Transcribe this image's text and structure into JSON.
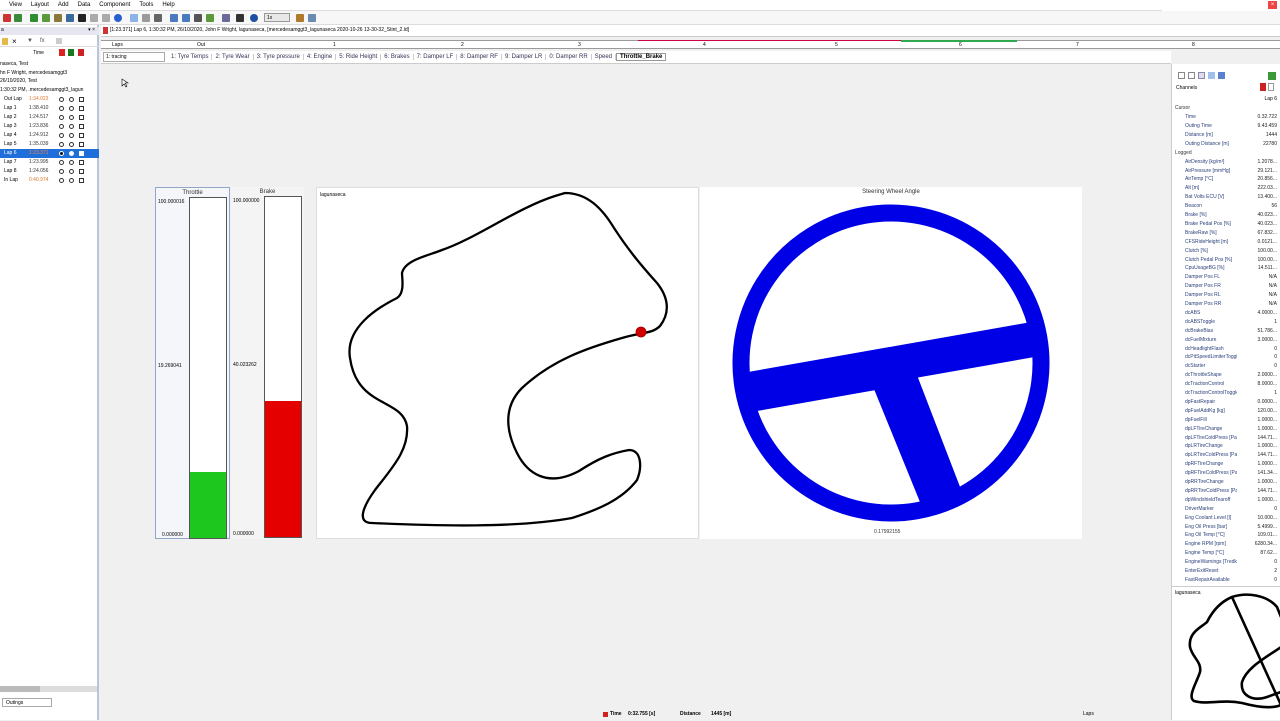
{
  "menu": {
    "items": [
      "View",
      "Layout",
      "Add",
      "Data",
      "Component",
      "Tools",
      "Help"
    ]
  },
  "toolbar": {
    "zoom_value": "1x"
  },
  "session": {
    "title": "[1:23.371] Lap 6, 1:30:32 PM, 26/10/2020, John F Wright, lagunaseca,  [mercedesamggt3_lagunaseca 2020-10-26 13-30-32_Stint_2.ld]"
  },
  "lapbar": {
    "label": "Laps",
    "out": "Out",
    "laps": [
      "1",
      "2",
      "3",
      "4",
      "5",
      "6",
      "7",
      "8"
    ]
  },
  "tabs": {
    "selector": "1: tracing",
    "items": [
      "1: Tyre Temps",
      "2: Tyre Wear",
      "3: Tyre pressure",
      "4: Engine",
      "5: Ride Height",
      "6: Brakes",
      "7: Damper LF",
      "8: Damper RF",
      "9: Damper LR",
      "0: Damper RR",
      "Speed",
      "Throttle_Brake"
    ]
  },
  "left": {
    "header_time": "Time",
    "session_name": "naseca, Test",
    "driver": "hn F Wright, mercedesamggt3",
    "date": "26/10/2020, Test",
    "stint": "1:30:32 PM, .mercedesamggt3_lagun",
    "laps": [
      {
        "name": "Out Lap",
        "time": "1:34.023",
        "color": "#e07b2c"
      },
      {
        "name": "Lap 1",
        "time": "1:38.410",
        "color": "#333"
      },
      {
        "name": "Lap 2",
        "time": "1:24.517",
        "color": "#333"
      },
      {
        "name": "Lap 3",
        "time": "1:23.836",
        "color": "#333"
      },
      {
        "name": "Lap 4",
        "time": "1:24.912",
        "color": "#333"
      },
      {
        "name": "Lap 5",
        "time": "1:35.039",
        "color": "#333"
      },
      {
        "name": "Lap 6",
        "time": "1:23.371",
        "color": "#e07b2c"
      },
      {
        "name": "Lap 7",
        "time": "1:23.995",
        "color": "#333"
      },
      {
        "name": "Lap 8",
        "time": "1:24.056",
        "color": "#333"
      },
      {
        "name": "In Lap",
        "time": "0:40.974",
        "color": "#e07b2c"
      }
    ],
    "footer_tab": "Outings"
  },
  "throttle": {
    "title": "Throttle",
    "max": "100.000016",
    "mid": "19.269041",
    "min": "0.000000",
    "level": 0.1927,
    "color": "#1ec71e"
  },
  "brake": {
    "title": "Brake",
    "max": "100.000000",
    "mid": "40.023262",
    "min": "0.000000",
    "level": 0.4002,
    "color": "#e50000"
  },
  "track": {
    "title": "lagunaseca"
  },
  "wheel": {
    "title": "Steering Wheel Angle",
    "value": "0.17992155",
    "color": "#0000e6"
  },
  "right": {
    "title": "Channels",
    "lap": "Lap 6",
    "cursor_header": "Cursor",
    "logged_header": "Logged",
    "cursor": [
      {
        "name": "Time",
        "value": "0.32.722"
      },
      {
        "name": "Outing Time",
        "value": "9.43.459"
      },
      {
        "name": "Distance [m]",
        "value": "1444"
      },
      {
        "name": "Outing Distance [m]",
        "value": "22780"
      }
    ],
    "logged": [
      {
        "name": "AirDensity [kg/m³]",
        "value": "1.2078..."
      },
      {
        "name": "AirPressure [mmHg]",
        "value": "29.121..."
      },
      {
        "name": "AirTemp [°C]",
        "value": "20.856..."
      },
      {
        "name": "Alt [m]",
        "value": "222.03..."
      },
      {
        "name": "Bat Volts ECU [V]",
        "value": "13.400..."
      },
      {
        "name": "Beacon",
        "value": "56"
      },
      {
        "name": "Brake [%]",
        "value": "40.023..."
      },
      {
        "name": "Brake Pedal Pos [%]",
        "value": "40.023..."
      },
      {
        "name": "BrakeRaw [%]",
        "value": "67.832..."
      },
      {
        "name": "CFSRideHeight [m]",
        "value": "0.0121..."
      },
      {
        "name": "Clutch [%]",
        "value": "100.00..."
      },
      {
        "name": "Clutch Pedal Pos [%]",
        "value": "100.00..."
      },
      {
        "name": "CpuUsageBG [%]",
        "value": "14.511..."
      },
      {
        "name": "Damper Pos FL",
        "value": "N/A"
      },
      {
        "name": "Damper Pos FR",
        "value": "N/A"
      },
      {
        "name": "Damper Pos RL",
        "value": "N/A"
      },
      {
        "name": "Damper Pos RR",
        "value": "N/A"
      },
      {
        "name": "dcABS",
        "value": "4.0000..."
      },
      {
        "name": "dcABSToggle",
        "value": "1"
      },
      {
        "name": "dcBrakeBias",
        "value": "51.786..."
      },
      {
        "name": "dcFuelMixture",
        "value": "3.0000..."
      },
      {
        "name": "dcHeadlightFlash",
        "value": "0"
      },
      {
        "name": "dcPitSpeedLimiterToggle",
        "value": "0"
      },
      {
        "name": "dcStarter",
        "value": "0"
      },
      {
        "name": "dcThrottleShape",
        "value": "2.0000..."
      },
      {
        "name": "dcTractionControl",
        "value": "8.0000..."
      },
      {
        "name": "dcTractionControlToggle",
        "value": "1"
      },
      {
        "name": "dpFastRepair",
        "value": "0.0000..."
      },
      {
        "name": "dpFuelAddKg [kg]",
        "value": "120.00..."
      },
      {
        "name": "dpFuelFill",
        "value": "1.0000..."
      },
      {
        "name": "dpLFTireChange",
        "value": "1.0000..."
      },
      {
        "name": "dpLFTireColdPress [Pa]",
        "value": "144.71..."
      },
      {
        "name": "dpLRTireChange",
        "value": "1.0000..."
      },
      {
        "name": "dpLRTireColdPress [Pa]",
        "value": "144.71..."
      },
      {
        "name": "dpRFTireChange",
        "value": "1.0000..."
      },
      {
        "name": "dpRFTireColdPress [Pa]",
        "value": "141.34..."
      },
      {
        "name": "dpRRTireChange",
        "value": "1.0000..."
      },
      {
        "name": "dpRRTireColdPress [Pa]",
        "value": "144.71..."
      },
      {
        "name": "dpWindshieldTearoff",
        "value": "1.0000..."
      },
      {
        "name": "DriverMarker",
        "value": "0"
      },
      {
        "name": "Eng Coolant Level [l]",
        "value": "10.000..."
      },
      {
        "name": "Eng Oil Press [bar]",
        "value": "5.4999..."
      },
      {
        "name": "Eng Oil Temp [°C]",
        "value": "109.01..."
      },
      {
        "name": "Engine RPM [rpm]",
        "value": "6280.34..."
      },
      {
        "name": "Engine Temp [°C]",
        "value": "87.62..."
      },
      {
        "name": "EngineWarnings [Tredk...",
        "value": "0"
      },
      {
        "name": "EnterExitReset",
        "value": "2"
      },
      {
        "name": "FastRepairAvailable",
        "value": "0"
      }
    ],
    "mini_track_title": "lagunaseca"
  },
  "status": {
    "time_label": "Time",
    "time_value": "0:32.755 [s]",
    "distance_label": "Distance",
    "distance_value": "1445 [m]",
    "laps_label": "Laps"
  }
}
